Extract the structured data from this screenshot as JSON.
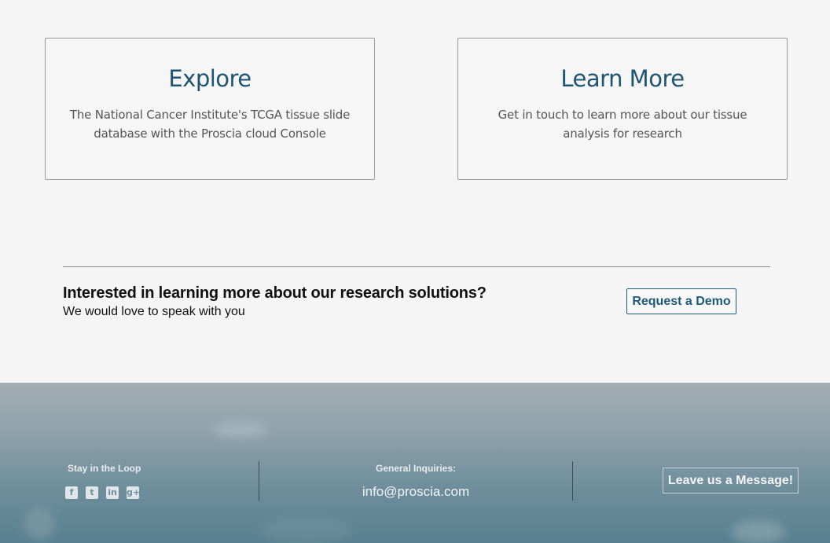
{
  "cards": [
    {
      "title": "Explore",
      "description": "The National Cancer Institute's TCGA tissue slide database with the Proscia cloud Console"
    },
    {
      "title": "Learn More",
      "description": "Get in touch to learn more about our tissue analysis for research"
    }
  ],
  "cta": {
    "heading": "Interested in learning more about our research solutions?",
    "subheading": "We would love to speak with you",
    "button_label": "Request a Demo"
  },
  "footer": {
    "stay_label": "Stay in the Loop",
    "social_icons": [
      "facebook-icon",
      "twitter-icon",
      "linkedin-icon",
      "google-plus-icon"
    ],
    "inquiries_label": "General Inquiries:",
    "email": "info@proscia.com",
    "message_button": "Leave us a Message!"
  },
  "colors": {
    "accent": "#1d5a7a",
    "page_bg": "#f5f5f5",
    "footer_bg": "#6f8e9c"
  }
}
